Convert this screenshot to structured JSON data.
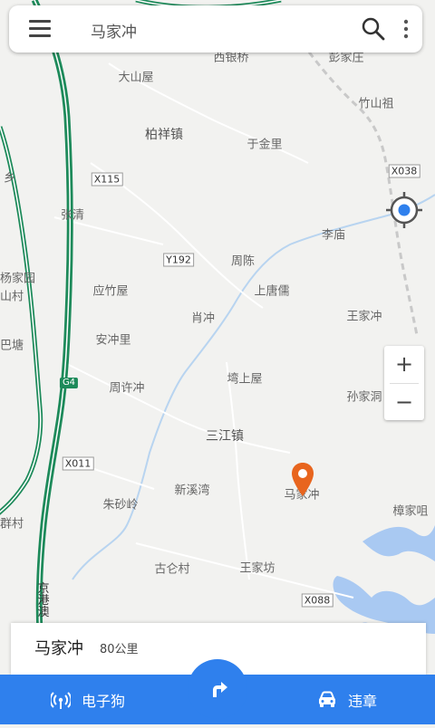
{
  "search": {
    "query": "马家冲"
  },
  "map": {
    "labels": [
      {
        "text": "西银桥",
        "cls": ""
      },
      {
        "text": "彭家庄",
        "cls": ""
      },
      {
        "text": "大山屋",
        "cls": ""
      },
      {
        "text": "竹山祖",
        "cls": ""
      },
      {
        "text": "柏祥镇",
        "cls": "town"
      },
      {
        "text": "于金里",
        "cls": ""
      },
      {
        "text": "X038",
        "cls": "road"
      },
      {
        "text": "X115",
        "cls": "road"
      },
      {
        "text": "张清",
        "cls": ""
      },
      {
        "text": "李庙",
        "cls": ""
      },
      {
        "text": "Y192",
        "cls": "road"
      },
      {
        "text": "周陈",
        "cls": ""
      },
      {
        "text": "应竹屋",
        "cls": ""
      },
      {
        "text": "上唐儒",
        "cls": ""
      },
      {
        "text": "肖冲",
        "cls": ""
      },
      {
        "text": "王家冲",
        "cls": ""
      },
      {
        "text": "安冲里",
        "cls": ""
      },
      {
        "text": "G4",
        "cls": "hwy"
      },
      {
        "text": "周许冲",
        "cls": ""
      },
      {
        "text": "塆上屋",
        "cls": ""
      },
      {
        "text": "孙家洞",
        "cls": ""
      },
      {
        "text": "三江镇",
        "cls": "town"
      },
      {
        "text": "X011",
        "cls": "road"
      },
      {
        "text": "新溪湾",
        "cls": ""
      },
      {
        "text": "马家冲",
        "cls": ""
      },
      {
        "text": "朱砂岭",
        "cls": ""
      },
      {
        "text": "樟家咀",
        "cls": ""
      },
      {
        "text": "古仑村",
        "cls": ""
      },
      {
        "text": "王家坊",
        "cls": ""
      },
      {
        "text": "X088",
        "cls": "road"
      },
      {
        "text": "京港澳",
        "cls": ""
      },
      {
        "text": "乡",
        "cls": ""
      },
      {
        "text": "杨家园",
        "cls": ""
      },
      {
        "text": "山村",
        "cls": ""
      },
      {
        "text": "巴塘",
        "cls": ""
      },
      {
        "text": "群村",
        "cls": ""
      }
    ]
  },
  "info_card": {
    "title": "马家冲",
    "distance": "80公里"
  },
  "bottom_bar": {
    "left_label": "电子狗",
    "right_label": "违章"
  },
  "colors": {
    "accent": "#2f80ed",
    "pin": "#e8651e",
    "highway": "#1d8a5a",
    "water": "#a9c9f2"
  }
}
